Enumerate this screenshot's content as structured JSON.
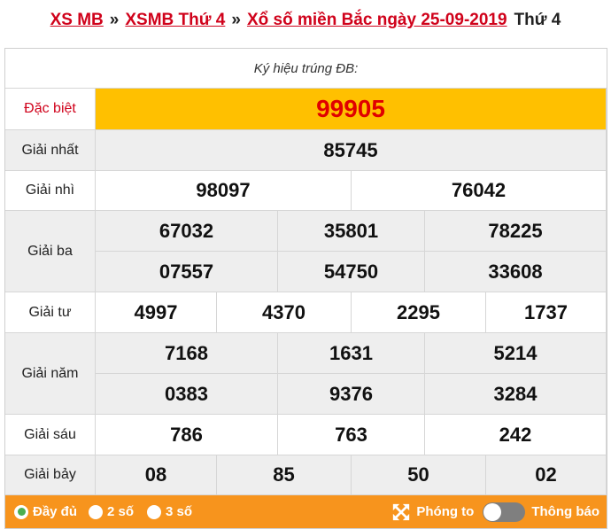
{
  "breadcrumb": {
    "items": [
      "XS MB",
      "XSMB Thứ 4",
      "Xổ số miền Bắc ngày 25-09-2019"
    ],
    "separator": "»",
    "current": "Thứ 4"
  },
  "symbol_label": "Ký hiệu trúng ĐB:",
  "prizes": {
    "special": {
      "label": "Đặc biệt",
      "numbers": [
        "99905"
      ]
    },
    "first": {
      "label": "Giải nhất",
      "numbers": [
        "85745"
      ]
    },
    "second": {
      "label": "Giải nhì",
      "numbers": [
        "98097",
        "76042"
      ]
    },
    "third": {
      "label": "Giải ba",
      "numbers": [
        "67032",
        "35801",
        "78225",
        "07557",
        "54750",
        "33608"
      ]
    },
    "fourth": {
      "label": "Giải tư",
      "numbers": [
        "4997",
        "4370",
        "2295",
        "1737"
      ]
    },
    "fifth": {
      "label": "Giải năm",
      "numbers": [
        "7168",
        "1631",
        "5214",
        "0383",
        "9376",
        "3284"
      ]
    },
    "sixth": {
      "label": "Giải sáu",
      "numbers": [
        "786",
        "763",
        "242"
      ]
    },
    "seventh": {
      "label": "Giải bảy",
      "numbers": [
        "08",
        "85",
        "50",
        "02"
      ]
    }
  },
  "footer": {
    "options": [
      "Đầy đủ",
      "2 số",
      "3 số"
    ],
    "selected_option": "Đầy đủ",
    "zoom_label": "Phóng to",
    "notify_label": "Thông báo",
    "notify_on": false
  },
  "colors": {
    "accent_red": "#d0021b",
    "special_bg": "#ffc000",
    "footer_bg": "#f7941d",
    "row_grey": "#eeeeee"
  }
}
